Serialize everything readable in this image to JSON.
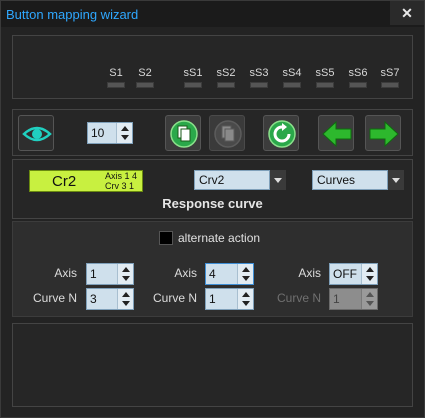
{
  "window": {
    "title": "Button mapping wizard",
    "close_glyph": "✕"
  },
  "switches": [
    "S1",
    "S2",
    "sS1",
    "sS2",
    "sS3",
    "sS4",
    "sS5",
    "sS6",
    "sS7"
  ],
  "toolbar": {
    "view_icon": "eye-icon",
    "number_value": "10",
    "copy_icon": "copy-icon",
    "paste_icon": "paste-icon",
    "refresh_icon": "refresh-icon",
    "prev_icon": "arrow-left-icon",
    "next_icon": "arrow-right-icon"
  },
  "curve": {
    "badge_name": "Cr2",
    "badge_line1": "Axis 1 4",
    "badge_line2": "Crv 3 1",
    "curve_select": "Crv2",
    "mode_select": "Curves",
    "heading": "Response curve"
  },
  "action": {
    "alternate_label": "alternate action",
    "col1": {
      "axis_label": "Axis",
      "axis_value": "1",
      "curve_label": "Curve N",
      "curve_value": "3"
    },
    "col2": {
      "axis_label": "Axis",
      "axis_value": "4",
      "curve_label": "Curve N",
      "curve_value": "1"
    },
    "col3": {
      "axis_label": "Axis",
      "axis_value": "OFF",
      "curve_label": "Curve N",
      "curve_value": "1"
    }
  },
  "colors": {
    "title": "#2fa8ff",
    "badge": "#c8f040",
    "green": "#2db82d"
  }
}
